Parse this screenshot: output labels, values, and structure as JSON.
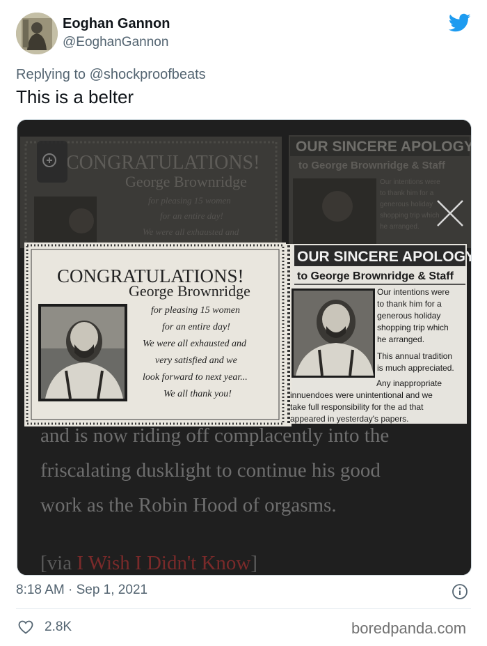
{
  "tweet": {
    "author_name": "Eoghan Gannon",
    "author_handle": "@EoghanGannon",
    "reply_prefix": "Replying to",
    "reply_to": "@shockproofbeats",
    "text": "This is a belter",
    "timestamp": "8:18 AM · Sep 1, 2021",
    "likes": "2.8K"
  },
  "media": {
    "background_ad": {
      "congrats_title": "CONGRATULATIONS!",
      "name": "George Brownridge",
      "lines": [
        "for pleasing 15 women",
        "for an entire day!",
        "We were all exhausted and"
      ],
      "apology_title": "OUR SINCERE APOLOGY",
      "apology_sub": "to George Brownridge & Staff",
      "apology_lines": [
        "Our intentions were",
        "to thank him for a",
        "generous holiday",
        "shopping trip which",
        "he arranged."
      ]
    },
    "congrats_ad": {
      "title": "CONGRATULATIONS!",
      "name": "George Brownridge",
      "lines": [
        "for pleasing 15 women",
        "for an entire day!",
        "We were all exhausted and",
        "very satisfied and we",
        "look forward to next year...",
        "We all thank you!"
      ]
    },
    "apology_ad": {
      "title": "OUR SINCERE APOLOGY",
      "subtitle": "to George Brownridge & Staff",
      "lines": [
        "Our intentions were",
        "to thank him for a",
        "generous holiday",
        "shopping trip which",
        "he arranged."
      ],
      "tradition_lines": [
        "This annual tradition",
        "is much appreciated."
      ],
      "footer_lines": [
        "Any inappropriate",
        "innuendoes were unintentional and we",
        "take full responsibility for the ad that",
        "appeared in yesterday's papers."
      ]
    },
    "article": {
      "line1": "and is now riding off complacently into the",
      "line2": "friscalating dusklight to continue his good",
      "line3": "work as the Robin Hood of orgasms.",
      "via_prefix": "[via ",
      "via_link": "I Wish I Didn't Know",
      "via_suffix": "]"
    }
  },
  "source": {
    "watermark": "boredpanda.com"
  },
  "icons": {
    "brand": "twitter-bird-icon",
    "close": "close-icon",
    "zoom": "zoom-icon",
    "info": "info-icon",
    "like": "heart-icon"
  },
  "colors": {
    "twitter_blue": "#1d9bf0",
    "secondary_text": "#536471",
    "apology_header_bg": "#2a2a2a",
    "clipping_paper": "#e9e6de"
  }
}
